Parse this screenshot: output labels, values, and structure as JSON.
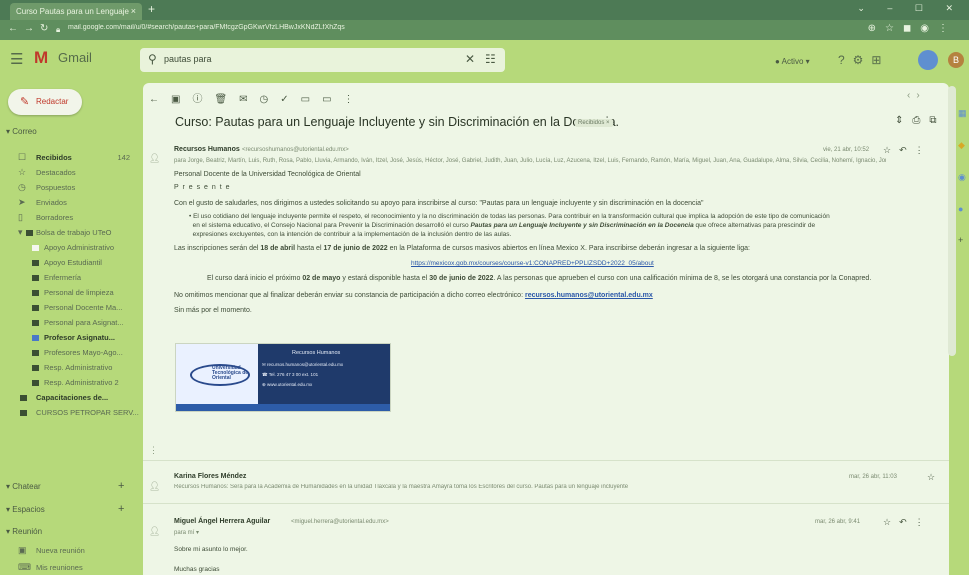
{
  "browser": {
    "tab_title": "Curso Pautas para un Lenguaje",
    "tab_close": "×",
    "new_tab": "+",
    "url": "mail.google.com/mail/u/0/#search/pautas+para/FMfcgzGpGKwrVfzLHBwJxKNdZLfXhZqs"
  },
  "header": {
    "menu_icon": "☰",
    "logo_text": "Gmail",
    "search_query": "pautas para",
    "status": "● Activo ▾"
  },
  "compose_label": "Redactar",
  "sidebar": {
    "correo": "Correo",
    "items": [
      {
        "icon": "☐",
        "label": "Recibidos",
        "count": "142"
      },
      {
        "icon": "☆",
        "label": "Destacados",
        "count": ""
      },
      {
        "icon": "◷",
        "label": "Pospuestos",
        "count": ""
      },
      {
        "icon": "➤",
        "label": "Enviados",
        "count": ""
      },
      {
        "icon": "▯",
        "label": "Borradores",
        "count": ""
      },
      {
        "icon": "▾",
        "label": "Bolsa de trabajo UTeO",
        "count": ""
      },
      {
        "icon": "",
        "label": "Apoyo Administrativo",
        "count": ""
      },
      {
        "icon": "",
        "label": "Apoyo Estudiantil",
        "count": ""
      },
      {
        "icon": "",
        "label": "Enfermería",
        "count": ""
      },
      {
        "icon": "",
        "label": "Personal de limpieza",
        "count": ""
      },
      {
        "icon": "",
        "label": "Personal Docente Ma...",
        "count": ""
      },
      {
        "icon": "",
        "label": "Personal para Asignat...",
        "count": ""
      },
      {
        "icon": "",
        "label": "Profesor Asignatu...",
        "count": ""
      },
      {
        "icon": "",
        "label": "Profesores Mayo-Ago...",
        "count": ""
      },
      {
        "icon": "",
        "label": "Resp. Administrativo",
        "count": ""
      },
      {
        "icon": "",
        "label": "Resp. Administrativo 2",
        "count": ""
      },
      {
        "icon": "",
        "label": "Capacitaciones de...",
        "count": ""
      },
      {
        "icon": "",
        "label": "CURSOS PETROPAR SERV...",
        "count": ""
      }
    ],
    "chat": "Chatear",
    "spaces": "Espacios",
    "meet": "Reunión",
    "meet_items": [
      "Nueva reunión",
      "Mis reuniones"
    ]
  },
  "email": {
    "subject": "Curso: Pautas para un Lenguaje Incluyente y sin Discriminación en la Docencia.",
    "label": "Recibidos ×",
    "sender": "Recursos Humanos",
    "sender_email": "<recursoshumanos@utoriental.edu.mx>",
    "recipients": "para Jorge, Beatriz, Martín, Luis, Ruth, Rosa, Pablo, Lluvia, Armando, Iván, Itzel, José, Jesús, Héctor, José, Gabriel, Judith, Juan, Julio, Lucía, Luz, Azucena, Itzel, Luis, Fernando, Ramón, María, Miguel, Juan, Ana, Guadalupe, Alma, Silvia, Cecilia, Nohemí, Ignacio, Jorge, Ruth ▾",
    "date": "vie, 21 abr, 10:52",
    "greeting": "Personal Docente de la Universidad Tecnológica de Oriental",
    "presente": "P r e s e n t e",
    "p1": "Con el gusto de saludarles, nos dirigimos a ustedes solicitando su apoyo para inscribirse al curso: \"Pautas para un lenguaje incluyente y sin discriminación en la docencia\"",
    "bullet_a": "El uso cotidiano del lenguaje incluyente permite el respeto, el reconocimiento y la no discriminación de todas las personas. Para contribuir en la transformación cultural que implica la adopción de este tipo de comunicación",
    "bullet_b_pre": "en el sistema educativo, el Consejo Nacional para Prevenir la Discriminación desarrolló el curso",
    "bullet_b_bold": "Pautas para un Lenguaje Incluyente y sin Discriminación en la Docencia",
    "bullet_b_post": "que ofrece alternativas para prescindir de",
    "bullet_c": "expresiones excluyentes, con la intención de contribuir a la implementación de la inclusión dentro de las aulas.",
    "p2_pre": "Las inscripciones serán del",
    "p2_d1": "18 de abril",
    "p2_mid": "hasta el",
    "p2_d2": "17 de junio de 2022",
    "p2_post": "en la Plataforma de cursos masivos abiertos en línea Mexico X. Para inscribirse deberán ingresar a la siguiente liga:",
    "url_link": "https://mexicox.gob.mx/courses/course-v1:CONAPRED+PPLIZSDD+2022_05/about",
    "p3_pre": "El curso dará inicio el próximo",
    "p3_d1": "02 de mayo",
    "p3_mid": "y estará disponible hasta el",
    "p3_d2": "30 de junio de 2022",
    "p3_post": ". A las personas que aprueben el curso con una calificación mínima de 8, se les otorgará una constancia por la Conapred.",
    "p4_pre": "No omitimos mencionar que al finalizar deberán enviar su constancia de participación a dicho correo electrónico:",
    "p4_link": "recursos.humanos@utoriental.edu.mx",
    "p5": "Sin más por el momento.",
    "banner_logo": "Universidad Tecnológica de Oriental",
    "banner_title": "Recursos Humanos",
    "banner_lines": [
      "recursos.humanos@utoriental.edu.mx",
      "Tel. 276 47 3 00 ext. 101",
      "www.utoriental.edu.mx"
    ],
    "dots": "⋮",
    "reply1_sender": "Karina Flores Méndez",
    "reply1_snippet": "Recursos Humanos: Será para la Academia de Humanidades en la unidad Tlaxcala y la maestra Amayra toma los Escritores del curso. Pautas para un lenguaje incluyente",
    "reply1_date": "mar, 26 abr, 11:03",
    "reply2_sender": "Miguel Ángel Herrera Aguilar",
    "reply2_email": "<miguel.herrera@utoriental.edu.mx>",
    "reply2_to": "para mí ▾",
    "reply2_date": "mar, 26 abr, 9:41",
    "reply2_line1": "Sobre mi asunto lo mejor.",
    "reply2_line2": "Muchas gracias"
  }
}
